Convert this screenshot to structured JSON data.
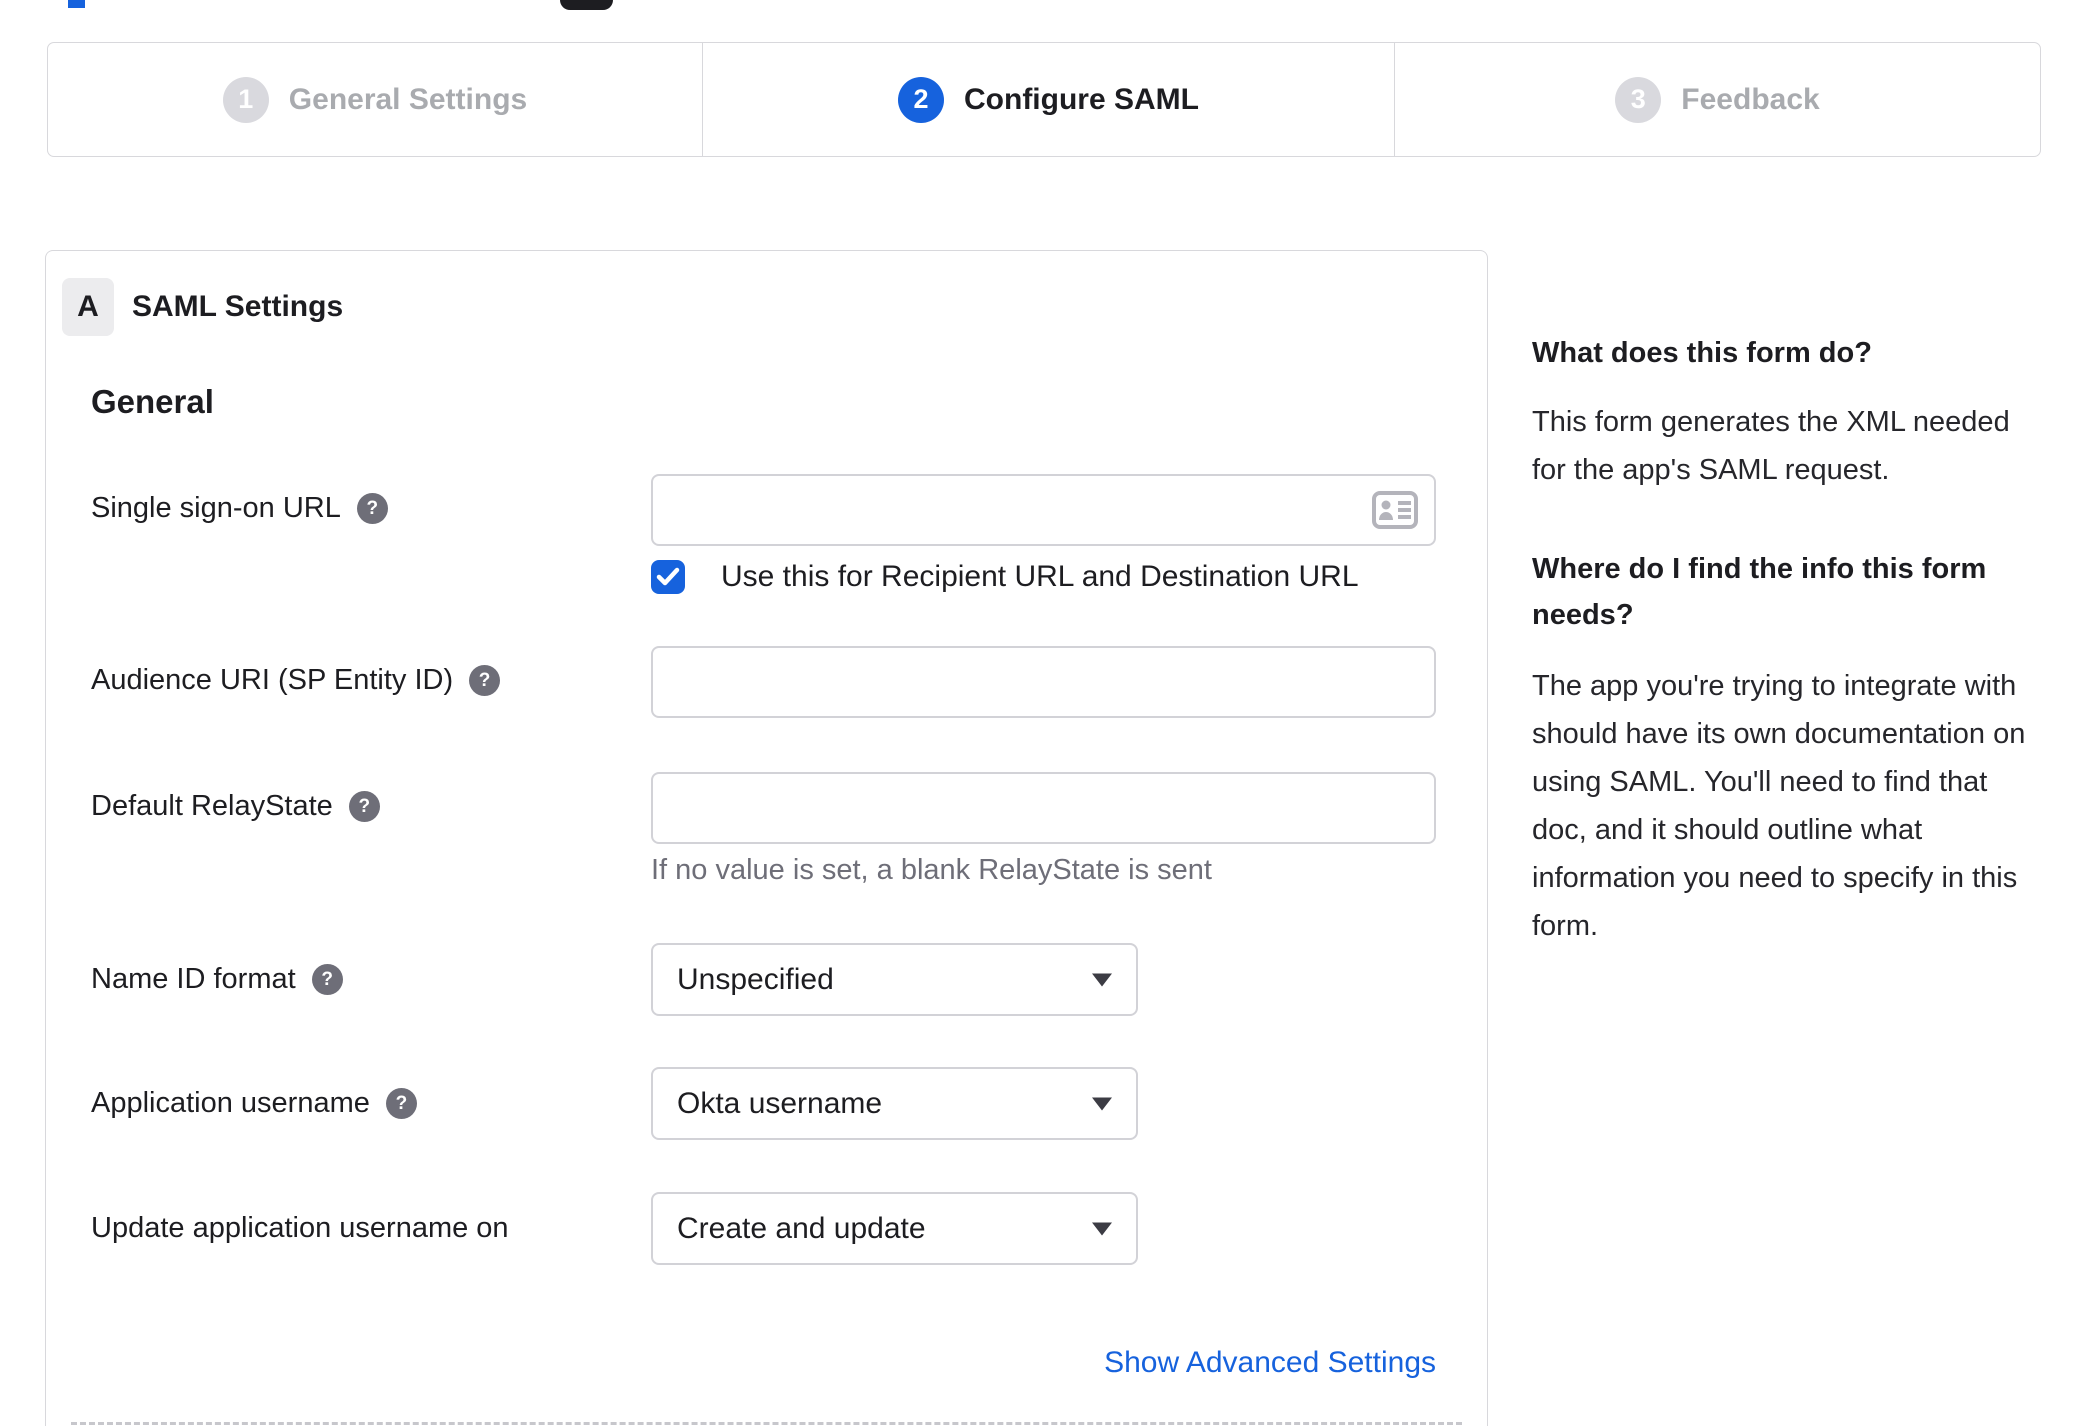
{
  "stepper": {
    "steps": [
      {
        "number": "1",
        "label": "General Settings",
        "state": "inactive"
      },
      {
        "number": "2",
        "label": "Configure SAML",
        "state": "active"
      },
      {
        "number": "3",
        "label": "Feedback",
        "state": "inactive"
      }
    ]
  },
  "panel": {
    "badge": "A",
    "title": "SAML Settings",
    "section_heading": "General",
    "fields": [
      {
        "label": "Single sign-on URL",
        "has_help": true,
        "type": "text",
        "value": "",
        "checkbox": {
          "checked": true,
          "label": "Use this for Recipient URL and Destination URL"
        }
      },
      {
        "label": "Audience URI (SP Entity ID)",
        "has_help": true,
        "type": "text",
        "value": ""
      },
      {
        "label": "Default RelayState",
        "has_help": true,
        "type": "text",
        "value": "",
        "helper": "If no value is set, a blank RelayState is sent"
      },
      {
        "label": "Name ID format",
        "has_help": true,
        "type": "select",
        "value": "Unspecified"
      },
      {
        "label": "Application username",
        "has_help": true,
        "type": "select",
        "value": "Okta username"
      },
      {
        "label": "Update application username on",
        "has_help": false,
        "type": "select",
        "value": "Create and update"
      }
    ],
    "advanced_link": "Show Advanced Settings"
  },
  "help_panel": {
    "section1_title": "What does this form do?",
    "section1_body": "This form generates the XML needed\nfor the app's SAML request.",
    "section2_title": "Where do I find the info this form\nneeds?",
    "section2_body": "The app you're trying to integrate with\nshould have its own documentation on\nusing SAML. You'll need to find that\ndoc, and it should outline what\ninformation you need to specify in this\nform."
  },
  "icons": {
    "help": "?",
    "sso_field_icon": "address-card",
    "checkbox_icon": "checkmark",
    "select_icon": "caret-down"
  },
  "colors": {
    "accent_blue": "#1662dd",
    "link_blue": "#1662dd",
    "inactive_step_gray": "#d9d9de",
    "inactive_label_gray": "#a9abaf",
    "text_dark": "#1d1d21",
    "muted_text": "#6e6e78",
    "border_gray": "#d8d8dc",
    "badge_bg": "#ececee"
  }
}
